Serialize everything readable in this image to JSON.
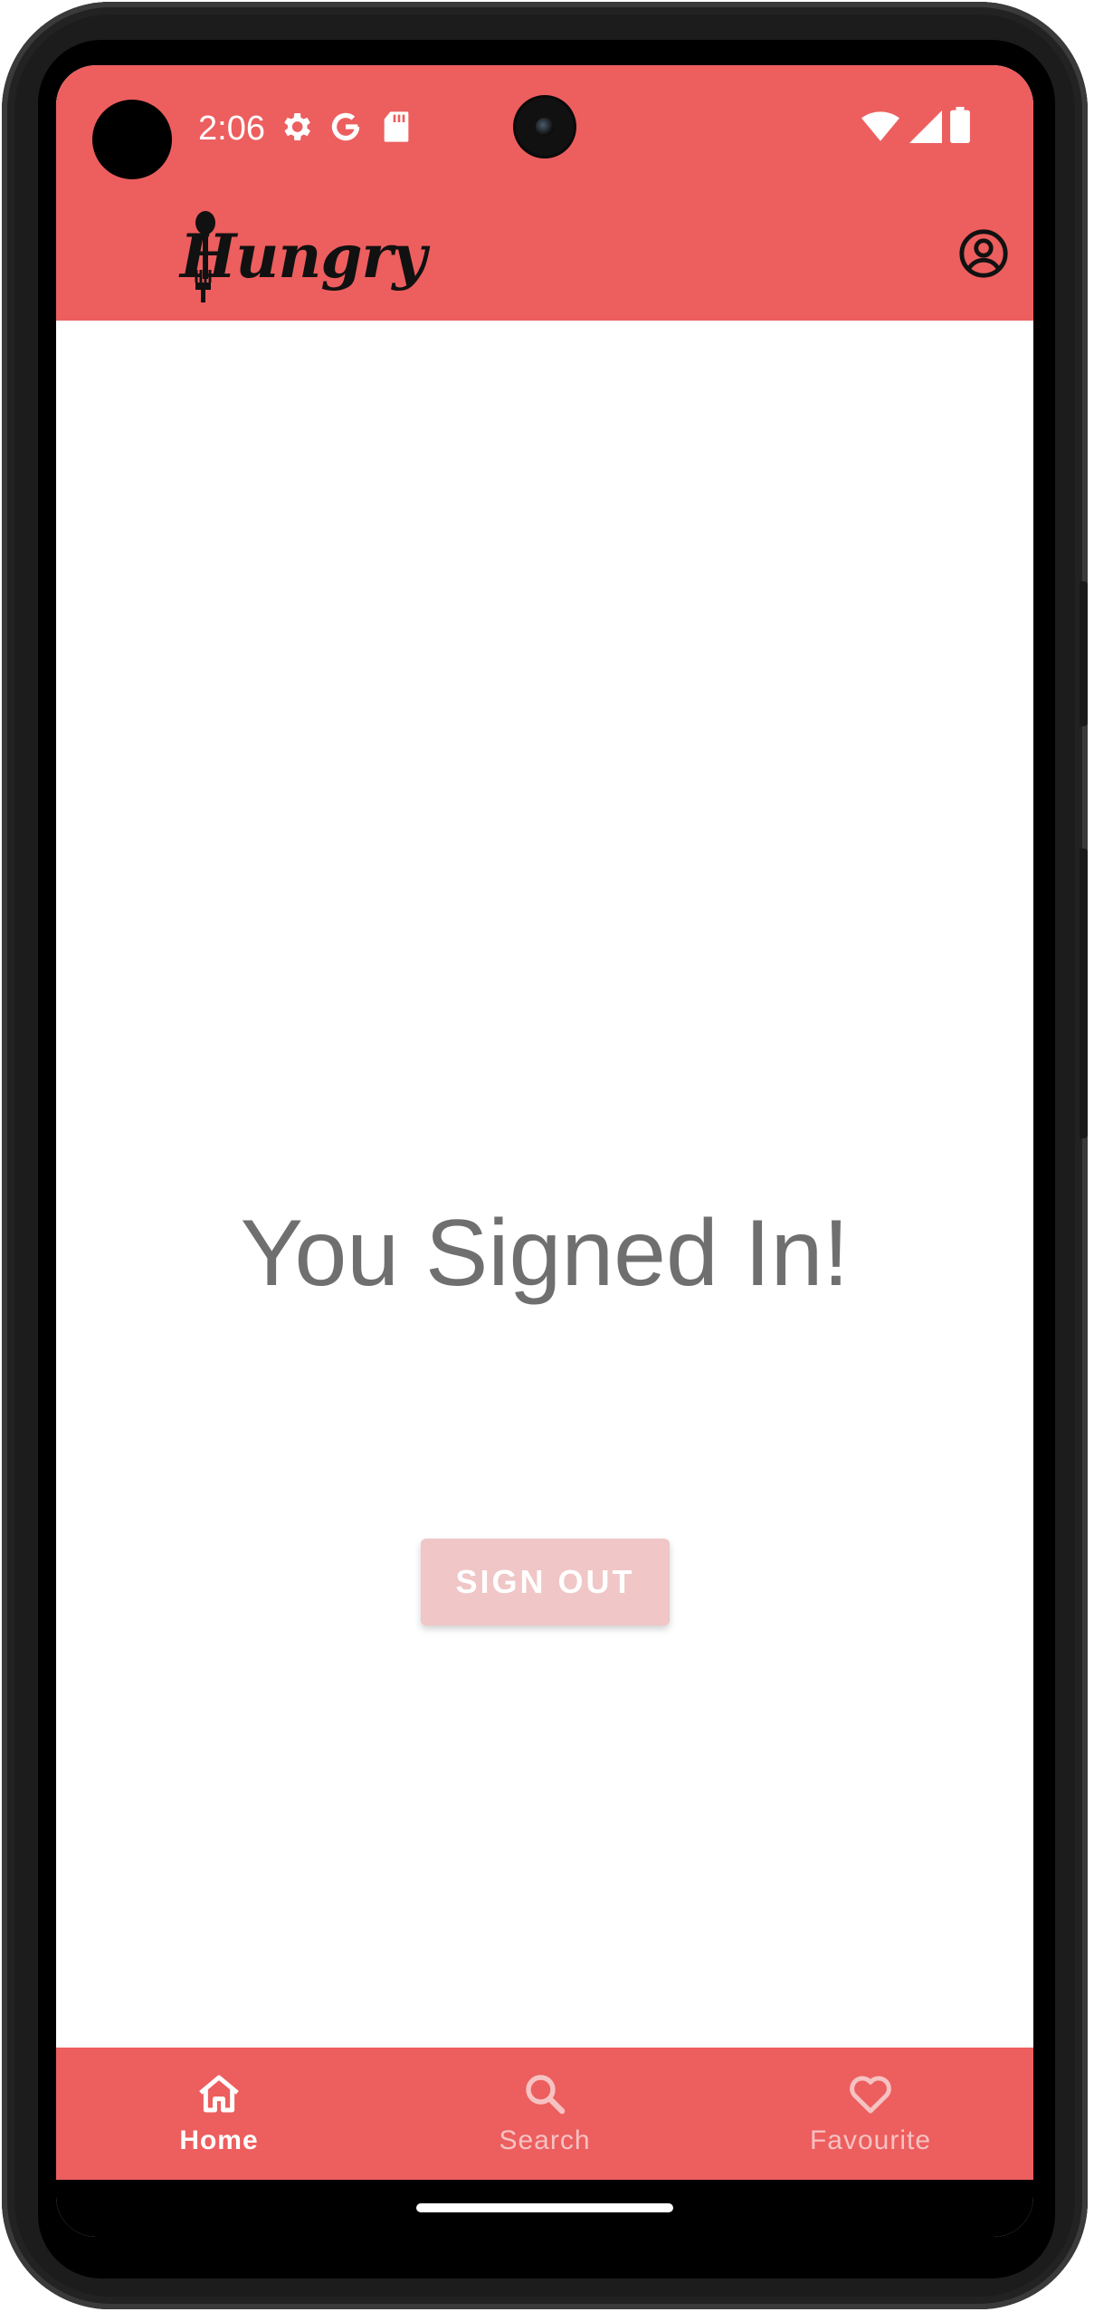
{
  "theme": {
    "accent": "#ED5E5E",
    "inactive_nav": "#F6C2C2",
    "signout_bg": "#F0C6C6"
  },
  "status_bar": {
    "time": "2:06",
    "left_icons": [
      "settings-gear-icon",
      "google-g-icon",
      "sd-card-icon"
    ],
    "right_icons": [
      "wifi-icon",
      "cell-signal-icon",
      "battery-icon"
    ]
  },
  "app_bar": {
    "logo_text": "Hungry",
    "profile_icon": "account-circle-icon"
  },
  "main": {
    "headline": "You Signed In!",
    "sign_out_label": "SIGN OUT"
  },
  "bottom_nav": {
    "items": [
      {
        "label": "Home",
        "icon": "home-icon",
        "active": true
      },
      {
        "label": "Search",
        "icon": "search-icon",
        "active": false
      },
      {
        "label": "Favourite",
        "icon": "heart-icon",
        "active": false
      }
    ]
  }
}
